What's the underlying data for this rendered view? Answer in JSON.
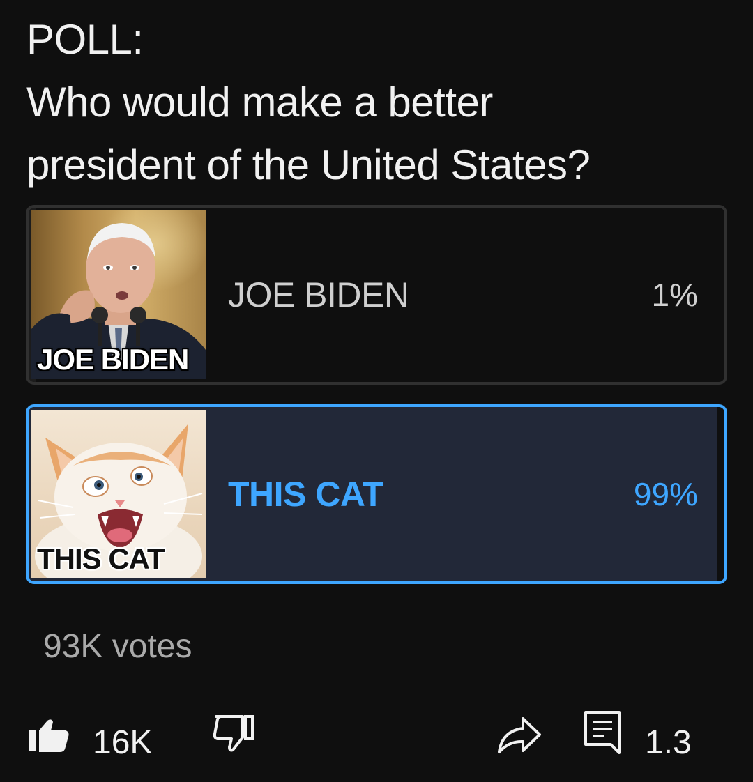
{
  "post": {
    "line1": "POLL:",
    "line2": "Who would make a better",
    "line3": "president of the United States?"
  },
  "poll": {
    "options": [
      {
        "label": "JOE BIDEN",
        "image_caption": "JOE BIDEN",
        "percent_text": "1%",
        "percent": 1,
        "selected": false
      },
      {
        "label": "THIS CAT",
        "image_caption": "THIS CAT",
        "percent_text": "99%",
        "percent": 99,
        "selected": true
      }
    ],
    "votes": "93K votes"
  },
  "actions": {
    "likes": "16K",
    "comments": "1.3",
    "icons": [
      "thumbs-up-icon",
      "thumbs-down-icon",
      "share-icon",
      "comment-icon"
    ]
  },
  "colors": {
    "background": "#0f0f0f",
    "accent": "#3ea6ff",
    "selected_fill": "#222838",
    "text_primary": "#f1f1f1",
    "text_secondary": "#aaaaaa"
  }
}
